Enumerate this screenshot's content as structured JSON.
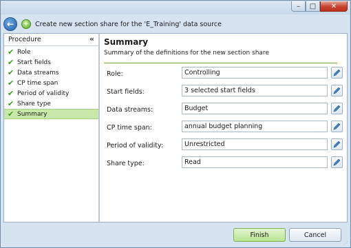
{
  "window": {
    "controls": {
      "minimize": "–",
      "maximize": "□",
      "close": "✕"
    }
  },
  "nav": {
    "back_icon": "back-arrow-icon",
    "wizard_icon": "green-plus-icon",
    "title": "Create new section share for the 'E_Training' data source"
  },
  "sidebar": {
    "title": "Procedure",
    "collapse_glyph": "«",
    "items": [
      {
        "label": "Role"
      },
      {
        "label": "Start fields"
      },
      {
        "label": "Data streams"
      },
      {
        "label": "CP time span"
      },
      {
        "label": "Period of validity"
      },
      {
        "label": "Share type"
      },
      {
        "label": "Summary",
        "active": true
      }
    ]
  },
  "main": {
    "title": "Summary",
    "subtitle": "Summary of the definitions for the new section share",
    "rows": [
      {
        "label": "Role:",
        "value": "Controlling"
      },
      {
        "label": "Start fields:",
        "value": "3 selected start fields"
      },
      {
        "label": "Data streams:",
        "value": "Budget"
      },
      {
        "label": "CP time span:",
        "value": "annual budget planning"
      },
      {
        "label": "Period of validity:",
        "value": "Unrestricted"
      },
      {
        "label": "Share type:",
        "value": "Read"
      }
    ]
  },
  "footer": {
    "finish_label": "Finish",
    "cancel_label": "Cancel"
  },
  "colors": {
    "accent_green": "#6aab3a",
    "active_item": "#c7e8a8"
  }
}
